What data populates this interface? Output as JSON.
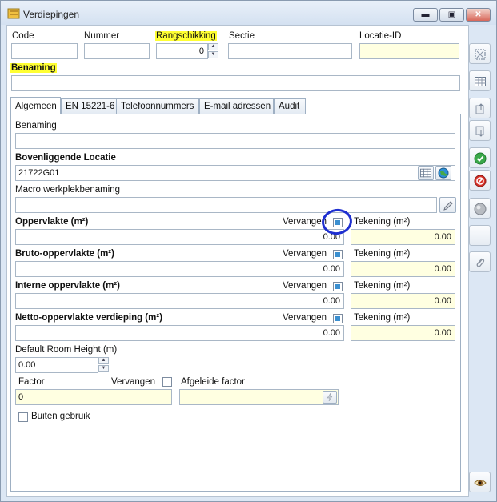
{
  "window": {
    "title": "Verdiepingen"
  },
  "header": {
    "code_label": "Code",
    "code_value": "",
    "nummer_label": "Nummer",
    "nummer_value": "",
    "rang_label": "Rangschikking",
    "rang_value": "0",
    "sectie_label": "Sectie",
    "sectie_value": "",
    "locatie_label": "Locatie-ID",
    "locatie_value": "",
    "benaming_label": "Benaming",
    "benaming_value": ""
  },
  "tabs": [
    "Algemeen",
    "EN 15221-6",
    "Telefoonnummers",
    "E-mail adressen",
    "Audit"
  ],
  "form": {
    "benaming_label": "Benaming",
    "benaming_value": "",
    "bovenliggende_label": "Bovenliggende Locatie",
    "bovenliggende_value": "21722G01",
    "macro_label": "Macro werkplekbenaming",
    "macro_value": "",
    "areas": [
      {
        "label": "Oppervlakte (m²)",
        "vervangen": "Vervangen",
        "tekening": "Tekening (m²)",
        "value": "0.00",
        "tekening_value": "0.00"
      },
      {
        "label": "Bruto-oppervlakte (m²)",
        "vervangen": "Vervangen",
        "tekening": "Tekening (m²)",
        "value": "0.00",
        "tekening_value": "0.00"
      },
      {
        "label": "Interne oppervlakte (m²)",
        "vervangen": "Vervangen",
        "tekening": "Tekening (m²)",
        "value": "0.00",
        "tekening_value": "0.00"
      },
      {
        "label": "Netto-oppervlakte verdieping (m²)",
        "vervangen": "Vervangen",
        "tekening": "Tekening (m²)",
        "value": "0.00",
        "tekening_value": "0.00"
      }
    ],
    "room_height_label": "Default Room Height (m)",
    "room_height_value": "0.00",
    "factor_label": "Factor",
    "factor_value": "0",
    "factor_vervangen": "Vervangen",
    "afgeleide_label": "Afgeleide factor",
    "afgeleide_value": "",
    "buiten_label": "Buiten gebruik"
  },
  "colors": {
    "highlight": "#ffff33",
    "annotation": "#1e2fd0",
    "checkbox_fill": "#3b8fd0",
    "readonly_field": "#ffffe1"
  }
}
